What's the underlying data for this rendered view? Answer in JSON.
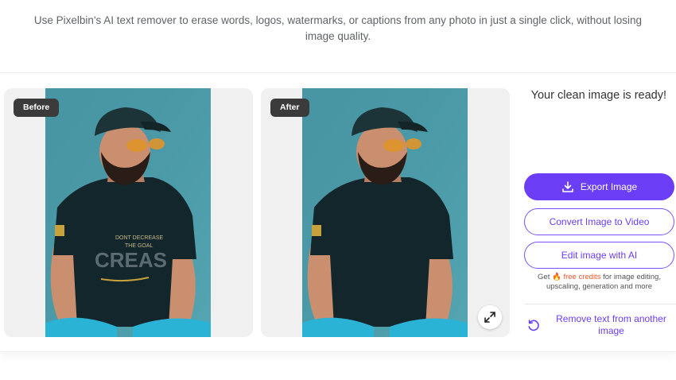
{
  "intro": {
    "description": "Use Pixelbin's AI text remover to erase words, logos, watermarks, or captions from any photo in just a single click, without losing image quality."
  },
  "comparison": {
    "before_label": "Before",
    "after_label": "After",
    "before_shirt_text": [
      "DONT DECREASE",
      "THE GOAL",
      "CREAS"
    ],
    "expand_icon": "expand-arrows-icon"
  },
  "result": {
    "ready_text": "Your clean image is ready!",
    "export_label": "Export Image",
    "export_icon": "download-icon",
    "convert_label": "Convert Image to Video",
    "edit_label": "Edit image with AI",
    "credits_prefix": "Get",
    "credits_emoji": "🔥",
    "credits_highlight": "free credits",
    "credits_suffix": "for image editing, upscaling, generation and more",
    "remove_another_label": "Remove text from another image",
    "remove_another_icon": "refresh-icon"
  },
  "colors": {
    "accent": "#6b3ef5",
    "credits_highlight": "#f05a28",
    "photo_background": "#4a98a6",
    "shirt": "#12262b",
    "jeans": "#2bb3d6"
  }
}
